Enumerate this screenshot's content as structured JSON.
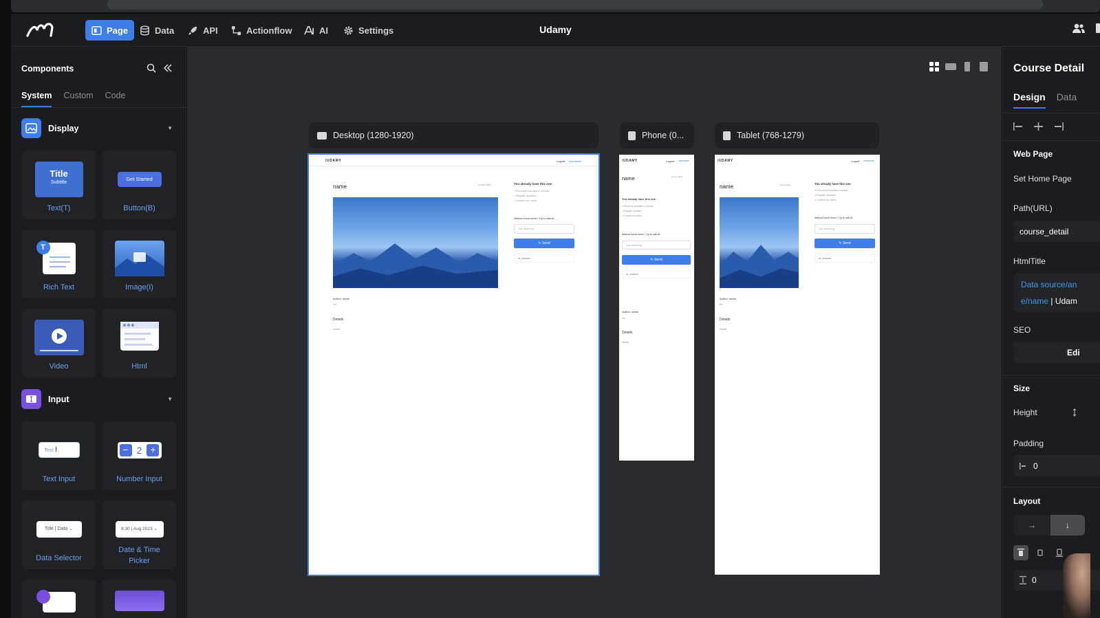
{
  "app": {
    "title": "Udamy",
    "nav": [
      {
        "label": "Page",
        "icon": "page-icon",
        "active": true
      },
      {
        "label": "Data",
        "icon": "database-icon",
        "active": false
      },
      {
        "label": "API",
        "icon": "rocket-icon",
        "active": false
      },
      {
        "label": "Actionflow",
        "icon": "flow-icon",
        "active": false
      },
      {
        "label": "AI",
        "icon": "ai-icon",
        "active": false
      },
      {
        "label": "Settings",
        "icon": "gear-icon",
        "active": false
      }
    ],
    "accent": "#3f7de8"
  },
  "components": {
    "title": "Components",
    "tabs": [
      "System",
      "Custom",
      "Code"
    ],
    "sections": {
      "display": "Display",
      "input": "Input"
    },
    "display_items": {
      "text": "Text(T)",
      "text_thumb_title": "Title",
      "text_thumb_subtitle": "Subtitle",
      "button": "Button(B)",
      "button_thumb": "Get Started",
      "rich_text": "Rich Text",
      "image": "Image(I)",
      "video": "Video",
      "html": "Html"
    },
    "input_items": {
      "text_input": "Text Input",
      "text_input_thumb": "Text",
      "number_input": "Number Input",
      "number_thumb": "2",
      "data_selector": "Data Selector",
      "data_selector_thumb_a": "Title",
      "data_selector_thumb_b": "Data",
      "datetime": "Date & Time Picker",
      "datetime_thumb_a": "8:30",
      "datetime_thumb_b": "Aug 2023"
    }
  },
  "canvas": {
    "viewports": {
      "desktop": "Desktop (1280-1920)",
      "phone": "Phone (0...",
      "tablet": "Tablet (768-1279)"
    },
    "preview": {
      "brand": "/UDAMY",
      "logout": "Logout",
      "username": "username",
      "name": "name",
      "course_label": "course label",
      "already_have": "You already have this one",
      "bullets": [
        "• Personal education License",
        "• Regular Updates",
        "• Created by name"
      ],
      "ai_prompt": "Wanna know more? Try to ask AI",
      "ask_placeholder": "Ask anything...",
      "send": "Send",
      "answer": "ai_answer",
      "author": "Author: name",
      "bio": "bio",
      "details_heading": "Details",
      "details": "details"
    }
  },
  "inspector": {
    "title": "Course Detail",
    "tabs": [
      "Design",
      "Data"
    ],
    "web_page": "Web Page",
    "set_home": "Set Home Page",
    "path_label": "Path(URL)",
    "path_value": "course_detail",
    "html_title_label": "HtmlTitle",
    "html_title_line1": "Data source/an",
    "html_title_line2a": "e/name",
    "html_title_line2b": " | Udam",
    "seo_label": "SEO",
    "seo_button": "Edi",
    "size_label": "Size",
    "height_label": "Height",
    "padding_label": "Padding",
    "padding_value": "0",
    "layout_label": "Layout",
    "gap_value": "0"
  }
}
